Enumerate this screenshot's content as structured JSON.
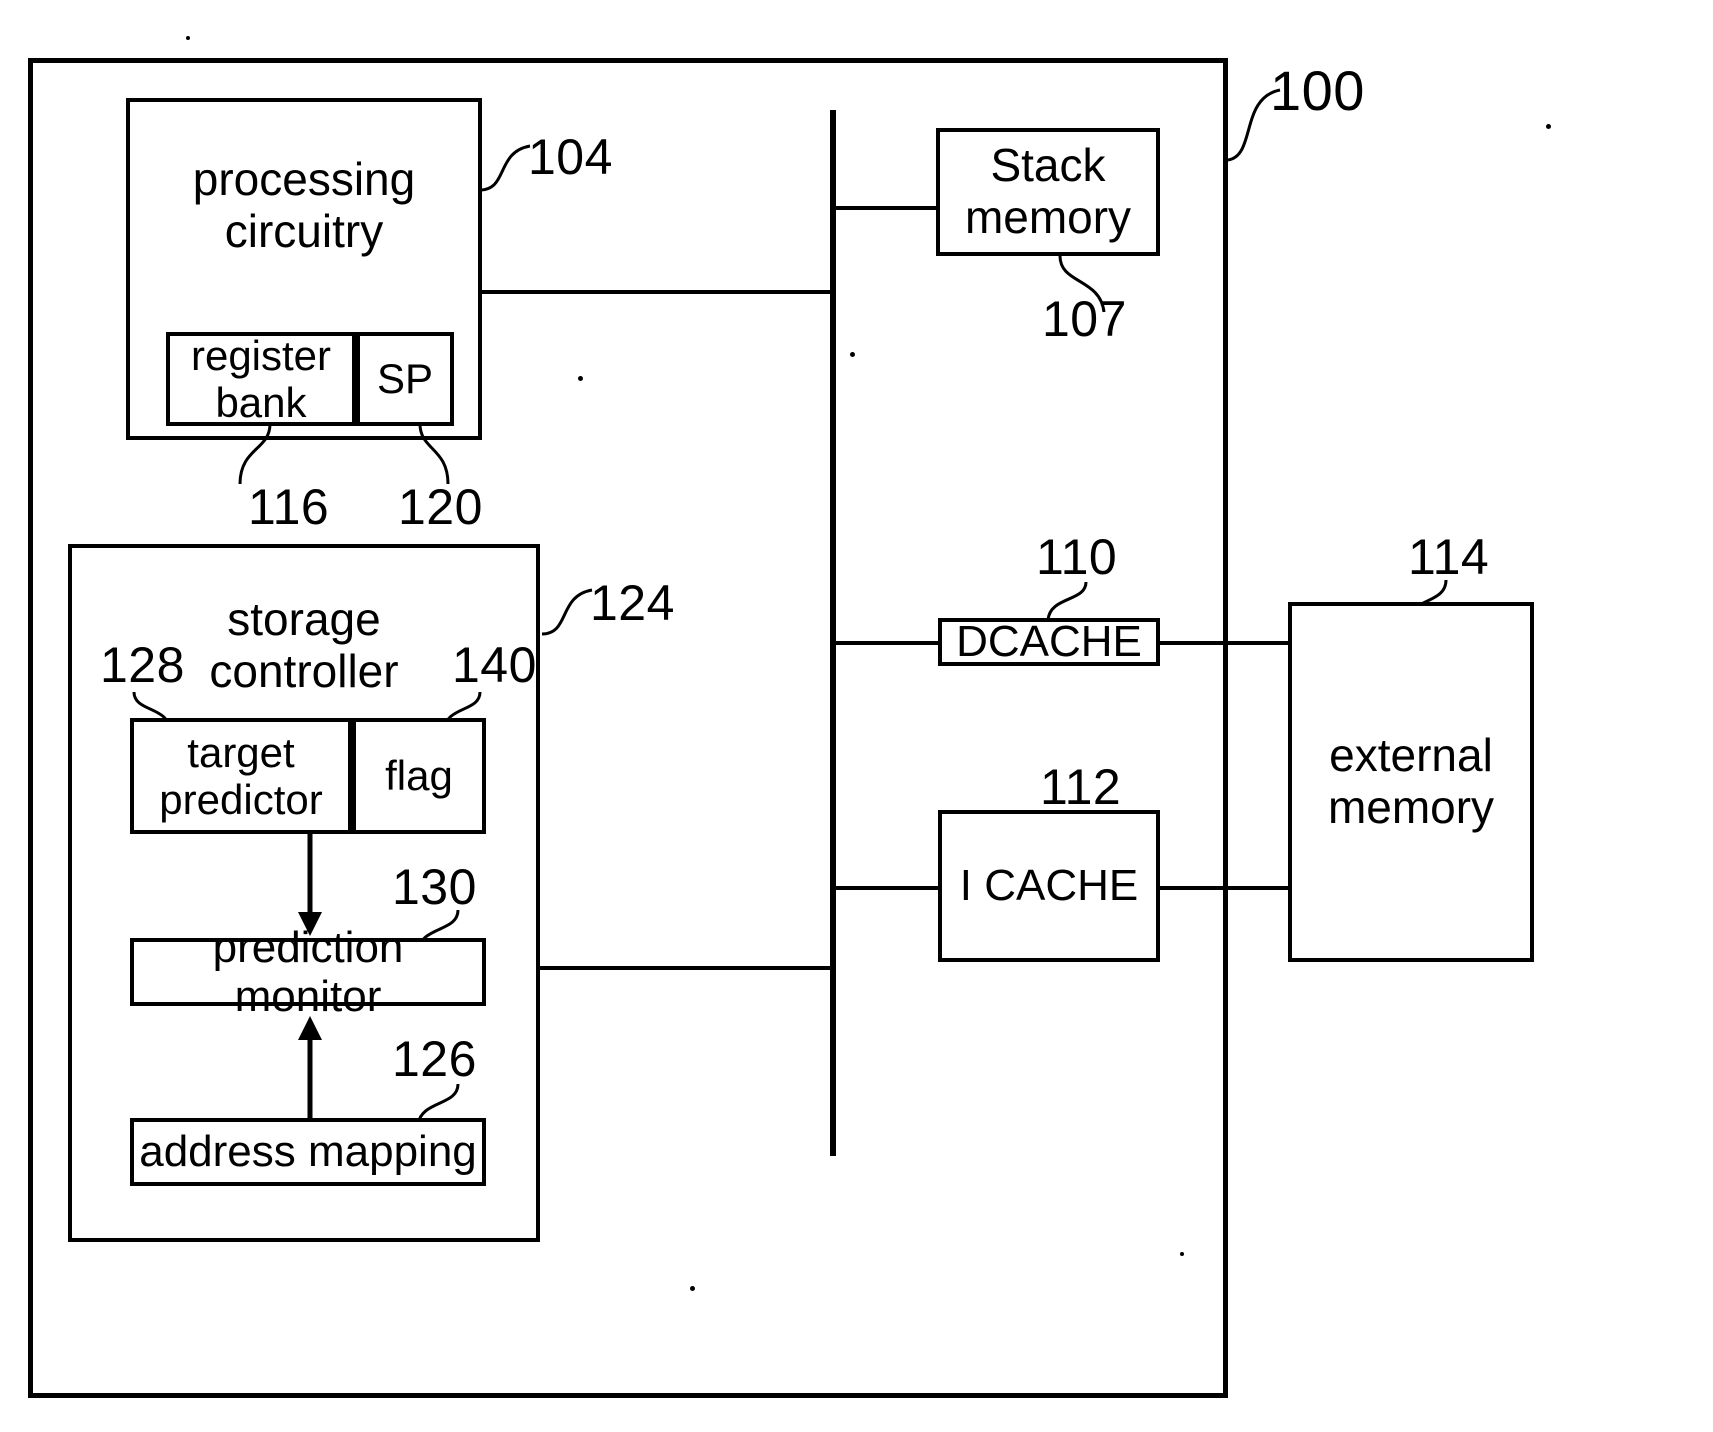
{
  "figure": {
    "type": "patent-block-diagram",
    "blocks": {
      "system": {
        "ref": "100",
        "label": ""
      },
      "processing_circuitry": {
        "ref": "104",
        "label": "processing\ncircuitry"
      },
      "register_bank": {
        "ref": "116",
        "label": "register\nbank"
      },
      "stack_pointer": {
        "ref": "120",
        "label": "SP"
      },
      "stack_memory": {
        "ref": "107",
        "label": "Stack\nmemory"
      },
      "dcache": {
        "ref": "110",
        "label": "DCACHE"
      },
      "icache": {
        "ref": "112",
        "label": "I CACHE"
      },
      "external_memory": {
        "ref": "114",
        "label": "external\nmemory"
      },
      "storage_controller": {
        "ref": "124",
        "label": "storage\ncontroller"
      },
      "target_predictor": {
        "ref": "128",
        "label": "target\npredictor"
      },
      "flag": {
        "ref": "140",
        "label": "flag"
      },
      "prediction_monitor": {
        "ref": "130",
        "label": "prediction monitor"
      },
      "address_mapping": {
        "ref": "126",
        "label": "address mapping"
      }
    },
    "reference_numerals": [
      "100",
      "104",
      "107",
      "110",
      "112",
      "114",
      "116",
      "120",
      "124",
      "126",
      "128",
      "130",
      "140"
    ],
    "connections": [
      {
        "from": "processing_circuitry",
        "to": "bus",
        "kind": "line"
      },
      {
        "from": "bus",
        "to": "stack_memory",
        "kind": "line"
      },
      {
        "from": "bus",
        "to": "dcache",
        "kind": "line"
      },
      {
        "from": "dcache",
        "to": "external_memory",
        "kind": "line"
      },
      {
        "from": "bus",
        "to": "icache",
        "kind": "line"
      },
      {
        "from": "icache",
        "to": "external_memory",
        "kind": "line"
      },
      {
        "from": "storage_controller",
        "to": "bus",
        "kind": "line"
      },
      {
        "from": "target_predictor",
        "to": "prediction_monitor",
        "kind": "arrow-down"
      },
      {
        "from": "address_mapping",
        "to": "prediction_monitor",
        "kind": "arrow-up"
      }
    ],
    "colors": {
      "stroke": "#000000",
      "background": "#ffffff"
    }
  }
}
